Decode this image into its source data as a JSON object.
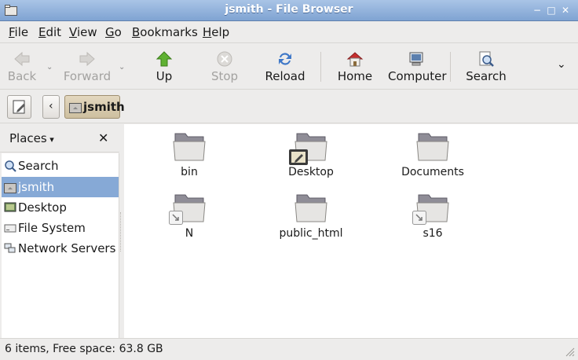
{
  "window": {
    "title": "jsmith - File Browser"
  },
  "menubar": {
    "items": [
      {
        "label": "File"
      },
      {
        "label": "Edit"
      },
      {
        "label": "View"
      },
      {
        "label": "Go"
      },
      {
        "label": "Bookmarks"
      },
      {
        "label": "Help"
      }
    ]
  },
  "toolbar": {
    "back": "Back",
    "forward": "Forward",
    "up": "Up",
    "stop": "Stop",
    "reload": "Reload",
    "home": "Home",
    "computer": "Computer",
    "search": "Search"
  },
  "location": {
    "current": "jsmith"
  },
  "sidebar": {
    "header": "Places",
    "items": [
      {
        "label": "Search",
        "icon": "search-icon",
        "selected": false
      },
      {
        "label": "jsmith",
        "icon": "home-folder-icon",
        "selected": true
      },
      {
        "label": "Desktop",
        "icon": "desktop-icon",
        "selected": false
      },
      {
        "label": "File System",
        "icon": "harddisk-icon",
        "selected": false
      },
      {
        "label": "Network Servers",
        "icon": "network-icon",
        "selected": false
      }
    ]
  },
  "files": [
    {
      "name": "bin",
      "emblem": ""
    },
    {
      "name": "Desktop",
      "emblem": "desktop"
    },
    {
      "name": "Documents",
      "emblem": ""
    },
    {
      "name": "N",
      "emblem": "symlink"
    },
    {
      "name": "public_html",
      "emblem": ""
    },
    {
      "name": "s16",
      "emblem": "symlink"
    }
  ],
  "status": {
    "text": "6 items, Free space: 63.8 GB"
  },
  "colors": {
    "titlebar": "#7fa3d2",
    "selection": "#86a9d6",
    "path_button": "#cdbf9f"
  }
}
